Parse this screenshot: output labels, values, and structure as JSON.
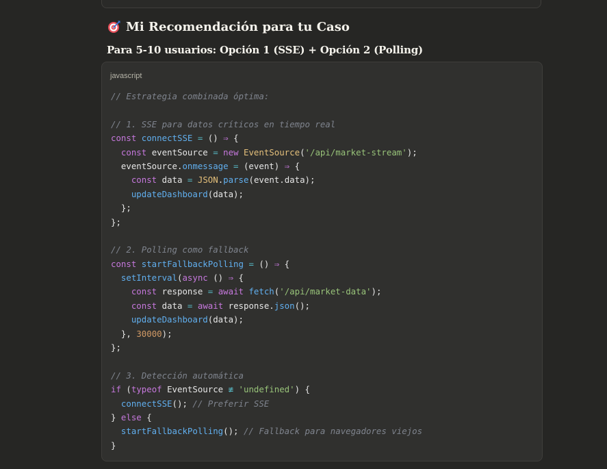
{
  "heading": {
    "icon": "target-icon",
    "title": "Mi Recomendación para tu Caso"
  },
  "subheading": "Para 5-10 usuarios: Opción 1 (SSE) + Opción 2 (Polling)",
  "code_block": {
    "language": "javascript",
    "token_colors": {
      "comment": "#7f848e",
      "keyword": "#c678dd",
      "function": "#61afef",
      "operator": "#56b6c2",
      "string": "#98c379",
      "class": "#e5c07b",
      "number": "#d19a66",
      "plain": "#e6e6e6"
    },
    "lines": [
      [
        [
          "comment",
          "// Estrategia combinada óptima:"
        ]
      ],
      [],
      [
        [
          "comment",
          "// 1. SSE para datos críticos en tiempo real"
        ]
      ],
      [
        [
          "keyword",
          "const "
        ],
        [
          "func",
          "connectSSE"
        ],
        [
          "plain",
          " "
        ],
        [
          "op",
          "="
        ],
        [
          "plain",
          " () "
        ],
        [
          "keyword",
          "⇒"
        ],
        [
          "plain",
          " {"
        ]
      ],
      [
        [
          "plain",
          "  "
        ],
        [
          "keyword",
          "const "
        ],
        [
          "plain",
          "eventSource "
        ],
        [
          "op",
          "="
        ],
        [
          "plain",
          " "
        ],
        [
          "keyword",
          "new "
        ],
        [
          "class",
          "EventSource"
        ],
        [
          "plain",
          "("
        ],
        [
          "string",
          "'/api/market-stream'"
        ],
        [
          "plain",
          ");"
        ]
      ],
      [
        [
          "plain",
          "  eventSource."
        ],
        [
          "func",
          "onmessage"
        ],
        [
          "plain",
          " "
        ],
        [
          "op",
          "="
        ],
        [
          "plain",
          " (event) "
        ],
        [
          "keyword",
          "⇒"
        ],
        [
          "plain",
          " {"
        ]
      ],
      [
        [
          "plain",
          "    "
        ],
        [
          "keyword",
          "const "
        ],
        [
          "plain",
          "data "
        ],
        [
          "op",
          "="
        ],
        [
          "plain",
          " "
        ],
        [
          "class",
          "JSON"
        ],
        [
          "plain",
          "."
        ],
        [
          "func",
          "parse"
        ],
        [
          "plain",
          "(event.data);"
        ]
      ],
      [
        [
          "plain",
          "    "
        ],
        [
          "func",
          "updateDashboard"
        ],
        [
          "plain",
          "(data);"
        ]
      ],
      [
        [
          "plain",
          "  };"
        ]
      ],
      [
        [
          "plain",
          "};"
        ]
      ],
      [],
      [
        [
          "comment",
          "// 2. Polling como fallback"
        ]
      ],
      [
        [
          "keyword",
          "const "
        ],
        [
          "func",
          "startFallbackPolling"
        ],
        [
          "plain",
          " "
        ],
        [
          "op",
          "="
        ],
        [
          "plain",
          " () "
        ],
        [
          "keyword",
          "⇒"
        ],
        [
          "plain",
          " {"
        ]
      ],
      [
        [
          "plain",
          "  "
        ],
        [
          "func",
          "setInterval"
        ],
        [
          "plain",
          "("
        ],
        [
          "keyword",
          "async"
        ],
        [
          "plain",
          " () "
        ],
        [
          "keyword",
          "⇒"
        ],
        [
          "plain",
          " {"
        ]
      ],
      [
        [
          "plain",
          "    "
        ],
        [
          "keyword",
          "const "
        ],
        [
          "plain",
          "response "
        ],
        [
          "op",
          "="
        ],
        [
          "plain",
          " "
        ],
        [
          "keyword",
          "await "
        ],
        [
          "func",
          "fetch"
        ],
        [
          "plain",
          "("
        ],
        [
          "string",
          "'/api/market-data'"
        ],
        [
          "plain",
          ");"
        ]
      ],
      [
        [
          "plain",
          "    "
        ],
        [
          "keyword",
          "const "
        ],
        [
          "plain",
          "data "
        ],
        [
          "op",
          "="
        ],
        [
          "plain",
          " "
        ],
        [
          "keyword",
          "await "
        ],
        [
          "plain",
          "response."
        ],
        [
          "func",
          "json"
        ],
        [
          "plain",
          "();"
        ]
      ],
      [
        [
          "plain",
          "    "
        ],
        [
          "func",
          "updateDashboard"
        ],
        [
          "plain",
          "(data);"
        ]
      ],
      [
        [
          "plain",
          "  }, "
        ],
        [
          "number",
          "30000"
        ],
        [
          "plain",
          ");"
        ]
      ],
      [
        [
          "plain",
          "};"
        ]
      ],
      [],
      [
        [
          "comment",
          "// 3. Detección automática"
        ]
      ],
      [
        [
          "keyword",
          "if "
        ],
        [
          "plain",
          "("
        ],
        [
          "keyword",
          "typeof "
        ],
        [
          "plain",
          "EventSource "
        ],
        [
          "op",
          "≢"
        ],
        [
          "plain",
          " "
        ],
        [
          "string",
          "'undefined'"
        ],
        [
          "plain",
          ") {"
        ]
      ],
      [
        [
          "plain",
          "  "
        ],
        [
          "func",
          "connectSSE"
        ],
        [
          "plain",
          "(); "
        ],
        [
          "comment",
          "// Preferir SSE"
        ]
      ],
      [
        [
          "plain",
          "} "
        ],
        [
          "keyword",
          "else"
        ],
        [
          "plain",
          " {"
        ]
      ],
      [
        [
          "plain",
          "  "
        ],
        [
          "func",
          "startFallbackPolling"
        ],
        [
          "plain",
          "(); "
        ],
        [
          "comment",
          "// Fallback para navegadores viejos"
        ]
      ],
      [
        [
          "plain",
          "}"
        ]
      ]
    ]
  }
}
